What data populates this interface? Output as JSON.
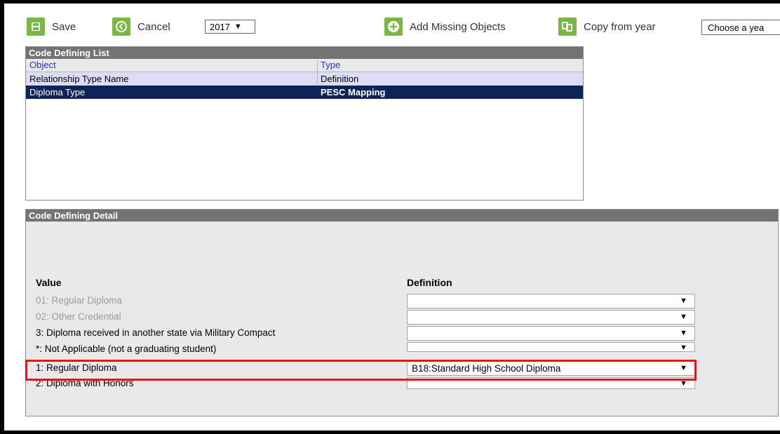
{
  "toolbar": {
    "save_label": "Save",
    "cancel_label": "Cancel",
    "year_value": "2017",
    "add_missing_label": "Add Missing Objects",
    "copy_from_year_label": "Copy from year",
    "choose_year_value": "Choose a yea"
  },
  "list_panel": {
    "title": "Code Defining List",
    "columns": [
      "Object",
      "Type"
    ],
    "rows": [
      {
        "object": "Relationship Type Name",
        "type": "Definition"
      },
      {
        "object": "Diploma Type",
        "type": "PESC Mapping"
      }
    ]
  },
  "detail_panel": {
    "title": "Code Defining Detail",
    "value_header": "Value",
    "definition_header": "Definition",
    "rows": [
      {
        "value": "01: Regular Diploma",
        "definition": ""
      },
      {
        "value": "02: Other Credential",
        "definition": ""
      },
      {
        "value": "3: Diploma received in another state via Military Compact",
        "definition": ""
      },
      {
        "value": "*: Not Applicable (not a graduating student)",
        "definition": ""
      },
      {
        "value": "1: Regular Diploma",
        "definition": "B18:Standard High School Diploma"
      },
      {
        "value": "2: Diploma with Honors",
        "definition": ""
      }
    ]
  },
  "colors": {
    "toolbar_icon": "#78b843",
    "panel_header": "#737373",
    "selected_row": "#0d2458",
    "alt_row": "#dcdcf6",
    "highlight": "#e8141b"
  },
  "icons": {
    "save": "save-icon",
    "cancel": "cancel-icon",
    "add_missing": "plus-circle-icon",
    "copy": "copy-icon",
    "dropdown": "triangle-down-icon"
  }
}
